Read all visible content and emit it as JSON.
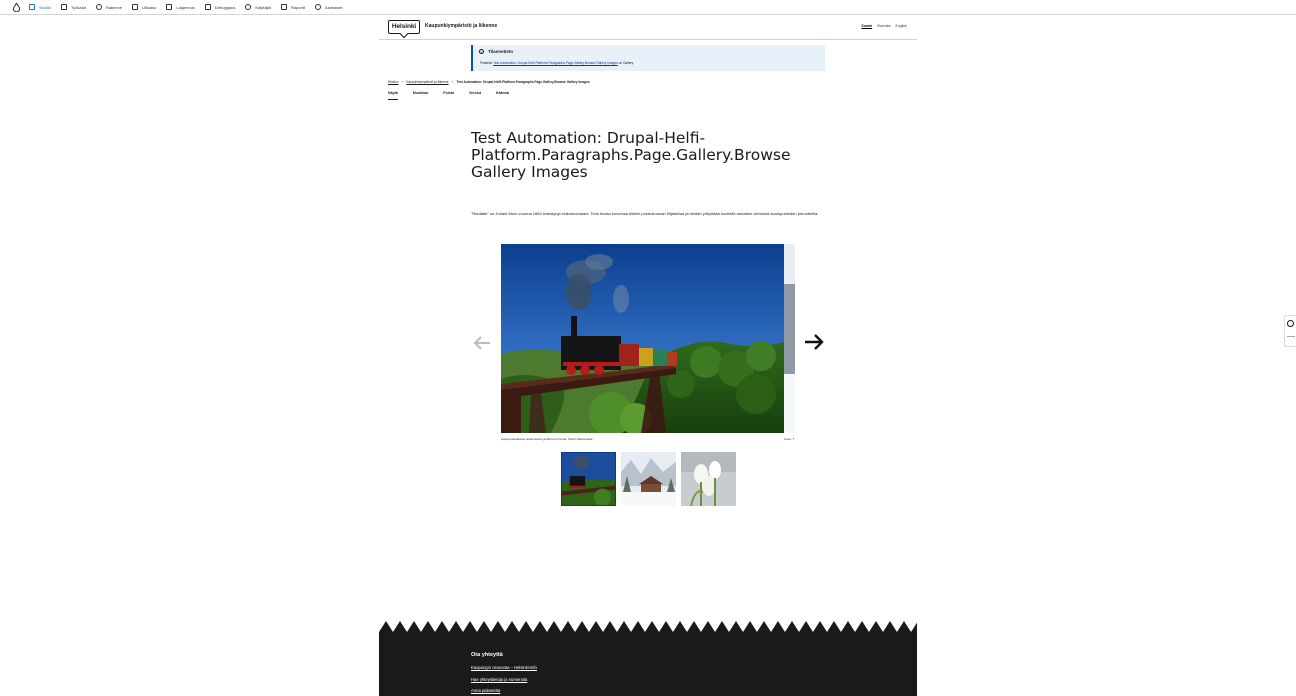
{
  "toolbar": {
    "items": [
      {
        "label": "Sisältö",
        "active": true
      },
      {
        "label": "Työkalut"
      },
      {
        "label": "Rakenne"
      },
      {
        "label": "Ulkoasu"
      },
      {
        "label": "Laajennus"
      },
      {
        "label": "Debuggaus"
      },
      {
        "label": "Käyttäjät"
      },
      {
        "label": "Raportit"
      },
      {
        "label": "Asetukset"
      }
    ]
  },
  "header": {
    "logo": "Helsinki",
    "site_name": "Kaupunkiympäristö ja liikenne",
    "languages": [
      "Suomi",
      "Svenska",
      "English"
    ]
  },
  "notice": {
    "title": "Tilannetieto",
    "prefix": "Poistettu",
    "link": "Test Automation: Drupal-Helfi-Platform.Paragraphs.Page.Gallery.Browse Gallery Images",
    "suffix": "on Gallery."
  },
  "breadcrumb": {
    "home": "Etusivu",
    "parent": "Kaupunkiympäristö ja liikenne",
    "sep": ">",
    "current": "Test Automation: Drupal-Helfi-Platform.Paragraphs.Page.Gallery.Browse Gallery Images"
  },
  "tabs": [
    "Näytä",
    "Muokkaa",
    "Poista",
    "Versiot",
    "Käännä"
  ],
  "page": {
    "title": "Test Automation: Drupal-Helfi-Platform.Paragraphs.Page.Gallery.Browse Gallery Images",
    "lead": "\"Rautatie\" on Juhani Ahon vuonna 1884 ilmestynyt esikoisromaani. Teos kuvaa korvessa eläviin porstukunnan hiljaiseloa ja heidän yritystään kuvitella rautatien olemusta kuulopuheiden perusteella."
  },
  "gallery": {
    "caption": "Aseta pakoattavat tekstit aseta gorilla kuvit Kuvat: Teksti Valokuvaaja",
    "caption_peek": "Kuva: T",
    "thumbnails": [
      "train",
      "snow-cabin",
      "tulips"
    ]
  },
  "footer": {
    "title": "Ota yhteyttä",
    "links": [
      "Kaupungin neuvonta – Helsinki-info",
      "Hae yhteystietoja ja numeroita",
      "Anna palautetta"
    ]
  },
  "colors": {
    "accent": "#0a4fb2",
    "notice_bg": "#e8f1fa",
    "footer_bg": "#1a1a1a"
  }
}
